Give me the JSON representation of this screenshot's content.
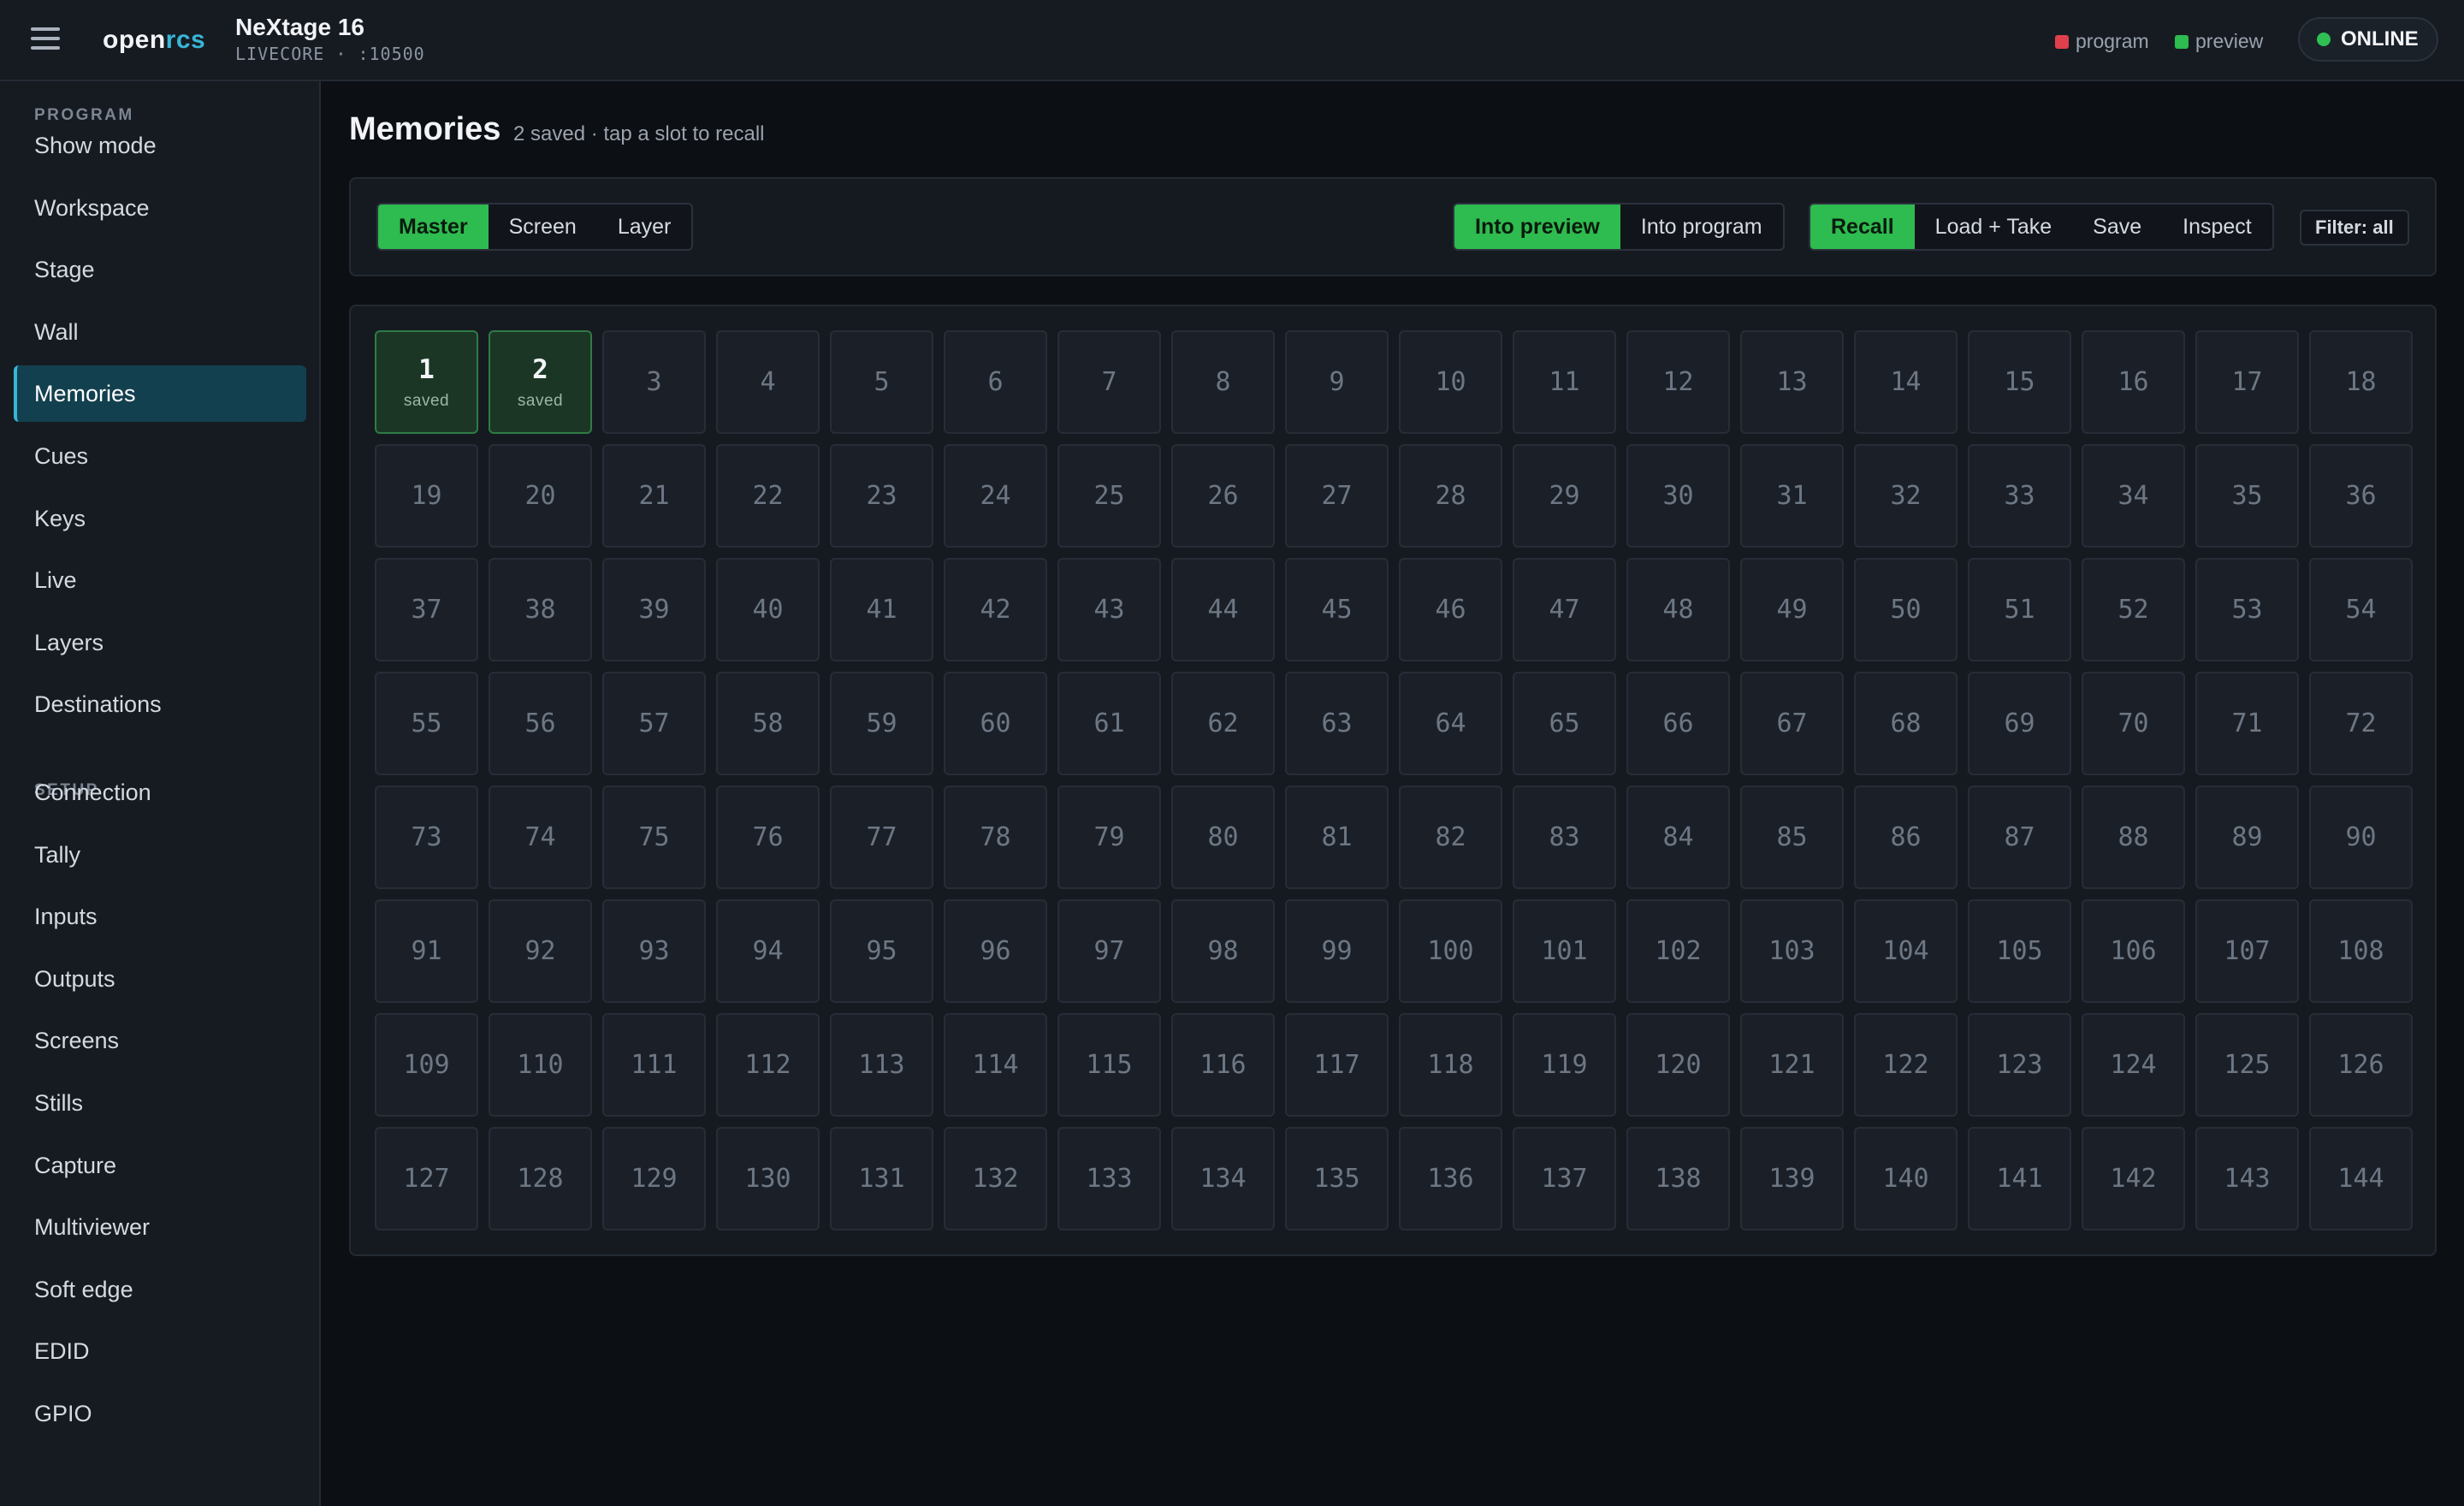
{
  "app": {
    "brand_a": "open",
    "brand_b": "rcs",
    "device_name": "NeXtage 16",
    "device_sub": "LIVECORE · :10500"
  },
  "header": {
    "legend_program": "program",
    "legend_preview": "preview",
    "status": "ONLINE"
  },
  "colors": {
    "program": "#e0404c",
    "preview": "#2ebb4f",
    "accent": "#38b6d6",
    "online": "#2fbf52"
  },
  "icons": {
    "menu": "hamburger-menu-icon",
    "status": "status-dot-icon"
  },
  "sidebar": {
    "program_label": "PROGRAM",
    "program_items": [
      "Show mode",
      "Workspace",
      "Stage",
      "Wall",
      "Memories",
      "Cues",
      "Keys",
      "Live",
      "Layers",
      "Destinations"
    ],
    "active": "Memories",
    "setup_label": "SETUP",
    "setup_items": [
      "Connection",
      "Tally",
      "Inputs",
      "Outputs",
      "Screens",
      "Stills",
      "Capture",
      "Multiviewer",
      "Soft edge",
      "EDID",
      "GPIO"
    ]
  },
  "main": {
    "title": "Memories",
    "subtitle": "2 saved · tap a slot to recall"
  },
  "toolbar": {
    "scope": {
      "options": [
        "Master",
        "Screen",
        "Layer"
      ],
      "selected": "Master"
    },
    "target": {
      "options": [
        "Into preview",
        "Into program"
      ],
      "selected": "Into preview"
    },
    "action": {
      "options": [
        "Recall",
        "Load + Take",
        "Save",
        "Inspect"
      ],
      "selected": "Recall"
    },
    "filter_label": "Filter: all"
  },
  "slots": {
    "count": 144,
    "saved": [
      1,
      2
    ],
    "saved_label": "saved"
  }
}
